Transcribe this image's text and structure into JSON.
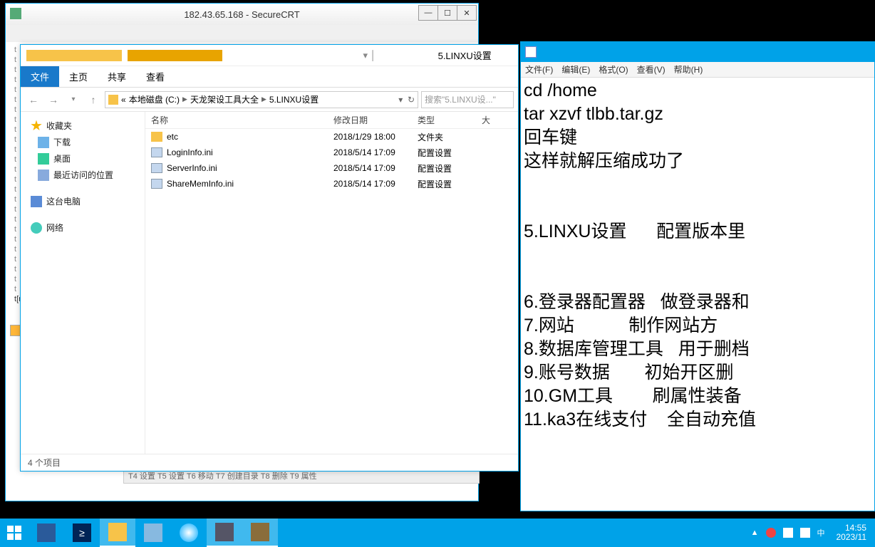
{
  "securecrt": {
    "title": "182.43.65.168 - SecureCRT",
    "bottom_text": "T4 设置 T5 设置 T6 移动 T7 创建目录 T8 删除 T9 属性"
  },
  "explorer": {
    "title": "5.LINXU设置",
    "ribbon": {
      "file": "文件",
      "home": "主页",
      "share": "共享",
      "view": "查看"
    },
    "breadcrumb": {
      "p0": "«",
      "p1": "本地磁盘 (C:)",
      "p2": "天龙架设工具大全",
      "p3": "5.LINXU设置"
    },
    "search_placeholder": "搜索\"5.LINXU设...\"",
    "columns": {
      "name": "名称",
      "date": "修改日期",
      "type": "类型",
      "size": "大"
    },
    "rows": [
      {
        "name": "etc",
        "date": "2018/1/29 18:00",
        "type": "文件夹",
        "icon": "folder"
      },
      {
        "name": "LoginInfo.ini",
        "date": "2018/5/14 17:09",
        "type": "配置设置",
        "icon": "ini"
      },
      {
        "name": "ServerInfo.ini",
        "date": "2018/5/14 17:09",
        "type": "配置设置",
        "icon": "ini"
      },
      {
        "name": "ShareMemInfo.ini",
        "date": "2018/5/14 17:09",
        "type": "配置设置",
        "icon": "ini"
      }
    ],
    "sidebar": {
      "fav": "收藏夹",
      "downloads": "下载",
      "desktop": "桌面",
      "recent": "最近访问的位置",
      "thispc": "这台电脑",
      "network": "网络"
    },
    "status": "4 个项目"
  },
  "notepad": {
    "menu": {
      "file": "文件(F)",
      "edit": "编辑(E)",
      "format": "格式(O)",
      "view": "查看(V)",
      "help": "帮助(H)"
    },
    "content": "cd /home\ntar xzvf tlbb.tar.gz\n回车键\n这样就解压缩成功了\n\n\n5.LINXU设置      配置版本里\n\n\n6.登录器配置器   做登录器和\n7.网站           制作网站方\n8.数据库管理工具   用于删档\n9.账号数据       初始开区删\n10.GM工具        刷属性装备\n11.ka3在线支付    全自动充值"
  },
  "taskbar": {
    "tray_up": "▲",
    "clock_time": "14:55",
    "clock_date": "2023/11"
  }
}
